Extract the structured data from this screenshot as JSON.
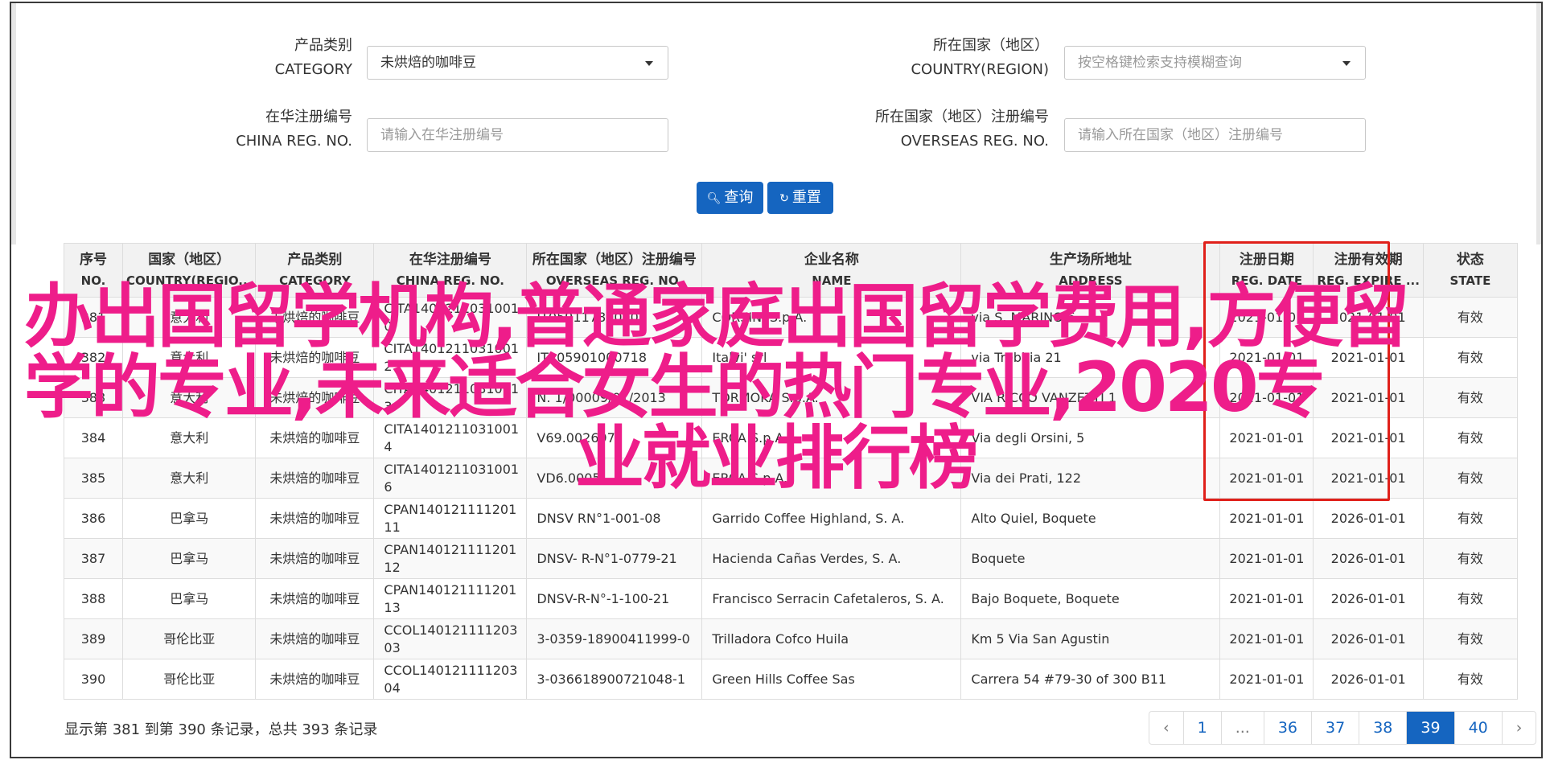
{
  "filters": {
    "category": {
      "label_cn": "产品类别",
      "label_en": "CATEGORY",
      "value": "未烘焙的咖啡豆"
    },
    "country": {
      "label_cn": "所在国家（地区）",
      "label_en": "COUNTRY(REGION)",
      "placeholder": "按空格键检索支持模糊查询"
    },
    "china_reg": {
      "label_cn": "在华注册编号",
      "label_en": "CHINA REG. NO.",
      "placeholder": "请输入在华注册编号"
    },
    "overseas_reg": {
      "label_cn": "所在国家（地区）注册编号",
      "label_en": "OVERSEAS REG. NO.",
      "placeholder": "请输入所在国家（地区）注册编号"
    }
  },
  "buttons": {
    "query": "查询",
    "reset": "重置"
  },
  "table": {
    "headers": [
      {
        "cn": "序号",
        "en": "NO."
      },
      {
        "cn": "国家（地区）",
        "en": "COUNTRY(REGIO..."
      },
      {
        "cn": "产品类别",
        "en": "CATEGORY"
      },
      {
        "cn": "在华注册编号",
        "en": "CHINA REG. NO."
      },
      {
        "cn": "所在国家（地区）注册编号",
        "en": "OVERSEAS REG. NO."
      },
      {
        "cn": "企业名称",
        "en": "NAME"
      },
      {
        "cn": "生产场所地址",
        "en": "ADDRESS"
      },
      {
        "cn": "注册日期",
        "en": "REG. DATE"
      },
      {
        "cn": "注册有效期",
        "en": "REG. EXPIRE ..."
      },
      {
        "cn": "状态",
        "en": "STATE"
      }
    ],
    "rows": [
      {
        "no": "381",
        "country": "意大利",
        "category": "未烘焙的咖啡豆",
        "china_reg": "CITA14012110310010",
        "overseas_reg": "IT05911780000",
        "name": "CORSINI S.p.A.",
        "address": "via S. MARINO 6",
        "reg_date": "2021-01-01",
        "expire": "2021-01-01",
        "state": "有效"
      },
      {
        "no": "382",
        "country": "意大利",
        "category": "未烘焙的咖啡豆",
        "china_reg": "CITA14012110310012",
        "overseas_reg": "IT205901000718",
        "name": "Italvi' srl",
        "address": "via Trebbia 21",
        "reg_date": "2021-01-01",
        "expire": "2021-01-01",
        "state": "有效"
      },
      {
        "no": "383",
        "country": "意大利",
        "category": "未烘焙的咖啡豆",
        "china_reg": "CITA14012110310013",
        "overseas_reg": "N. 1/00009/01/2013",
        "name": "TORMOKA S.p.A.",
        "address": "VIA RICCO VANZETTI 1",
        "reg_date": "2021-01-01",
        "expire": "2021-01-01",
        "state": "有效"
      },
      {
        "no": "384",
        "country": "意大利",
        "category": "未烘焙的咖啡豆",
        "china_reg": "CITA14012110310014",
        "overseas_reg": "V69.002697",
        "name": "ERCA S.p.A.",
        "address": "Via degli Orsini, 5",
        "reg_date": "2021-01-01",
        "expire": "2021-01-01",
        "state": "有效"
      },
      {
        "no": "385",
        "country": "意大利",
        "category": "未烘焙的咖啡豆",
        "china_reg": "CITA14012110310016",
        "overseas_reg": "VD6.0005",
        "name": "ERCA S.p.A.",
        "address": "Via dei Prati, 122",
        "reg_date": "2021-01-01",
        "expire": "2021-01-01",
        "state": "有效"
      },
      {
        "no": "386",
        "country": "巴拿马",
        "category": "未烘焙的咖啡豆",
        "china_reg": "CPAN14012111120111",
        "overseas_reg": "DNSV RN°1-001-08",
        "name": "Garrido Coffee Highland, S. A.",
        "address": "Alto Quiel, Boquete",
        "reg_date": "2021-01-01",
        "expire": "2026-01-01",
        "state": "有效"
      },
      {
        "no": "387",
        "country": "巴拿马",
        "category": "未烘焙的咖啡豆",
        "china_reg": "CPAN14012111120112",
        "overseas_reg": "DNSV- R-N°1-0779-21",
        "name": "Hacienda Cañas Verdes, S. A.",
        "address": "Boquete",
        "reg_date": "2021-01-01",
        "expire": "2026-01-01",
        "state": "有效"
      },
      {
        "no": "388",
        "country": "巴拿马",
        "category": "未烘焙的咖啡豆",
        "china_reg": "CPAN14012111120113",
        "overseas_reg": "DNSV-R-N°-1-100-21",
        "name": "Francisco Serracin Cafetaleros, S. A.",
        "address": "Bajo Boquete, Boquete",
        "reg_date": "2021-01-01",
        "expire": "2026-01-01",
        "state": "有效"
      },
      {
        "no": "389",
        "country": "哥伦比亚",
        "category": "未烘焙的咖啡豆",
        "china_reg": "CCOL14012111120303",
        "overseas_reg": "3-0359-18900411999-0",
        "name": "Trilladora Cofco Huila",
        "address": "Km 5 Via San Agustin",
        "reg_date": "2021-01-01",
        "expire": "2026-01-01",
        "state": "有效"
      },
      {
        "no": "390",
        "country": "哥伦比亚",
        "category": "未烘焙的咖啡豆",
        "china_reg": "CCOL14012111120304",
        "overseas_reg": "3-036618900721048-1",
        "name": "Green Hills Coffee Sas",
        "address": "Carrera 54 #79-30 of 300 B11",
        "reg_date": "2021-01-01",
        "expire": "2026-01-01",
        "state": "有效"
      }
    ]
  },
  "overlay": {
    "line1": "办出国留学机构,普通家庭出国留学费用,方便留",
    "line2": "学的专业,未来适合女生的热门专业,2020专",
    "line3": "业就业排行榜"
  },
  "footer": {
    "summary": "显示第 381 到第 390 条记录，总共 393 条记录"
  },
  "pagination": {
    "prev": "‹",
    "pages": [
      "1",
      "...",
      "36",
      "37",
      "38",
      "39",
      "40"
    ],
    "active": "39",
    "next": "›"
  },
  "colors": {
    "primary": "#1565c0",
    "highlight_box": "#e0201a",
    "overlay_text": "#ee1d8a"
  }
}
